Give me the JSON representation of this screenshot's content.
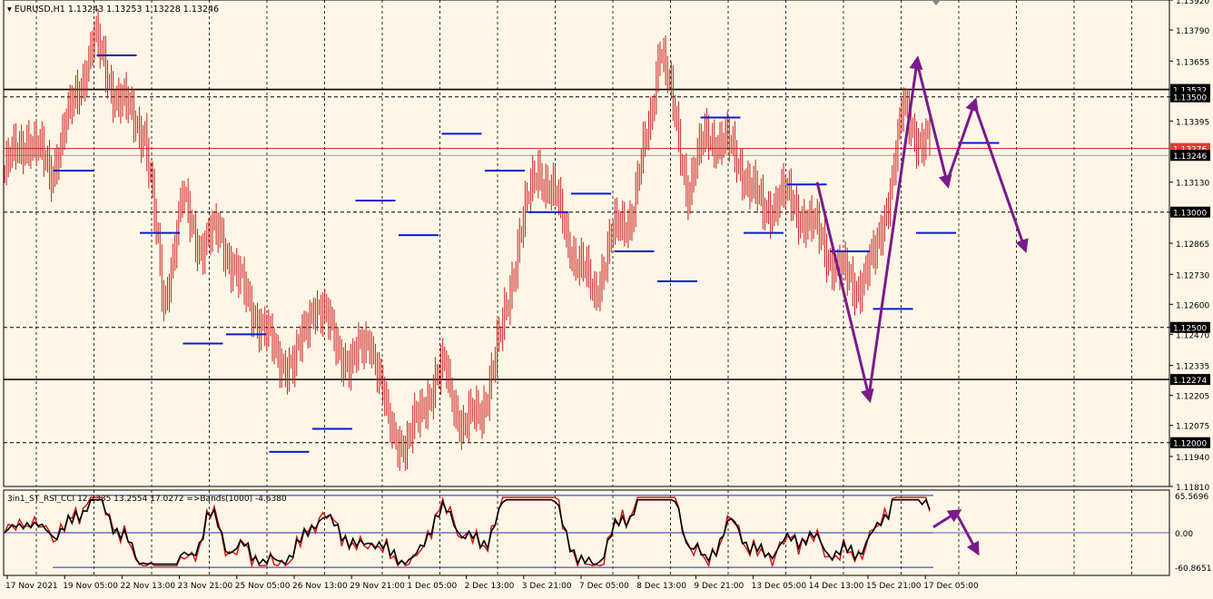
{
  "chart_data": [
    {
      "type": "candlestick",
      "header": {
        "symbol_timeframe": "EURUSD,H1",
        "open": "1.13243",
        "high": "1.13253",
        "low": "1.13228",
        "close": "1.13246"
      },
      "ylim": [
        1.1181,
        1.1392
      ],
      "y_ticks": [
        "1.13920",
        "1.13790",
        "1.13655",
        "1.13500",
        "1.13395",
        "1.13130",
        "1.13000",
        "1.12865",
        "1.12730",
        "1.12600",
        "1.12500",
        "1.12470",
        "1.12335",
        "1.12205",
        "1.12075",
        "1.12000",
        "1.11940",
        "1.11810"
      ],
      "x_ticks": [
        "17 Nov 2021",
        "19 Nov 05:00",
        "22 Nov 13:00",
        "23 Nov 21:00",
        "25 Nov 05:00",
        "26 Nov 13:00",
        "29 Nov 21:00",
        "1 Dec 05:00",
        "2 Dec 13:00",
        "3 Dec 21:00",
        "7 Dec 05:00",
        "8 Dec 13:00",
        "9 Dec 21:00",
        "13 Dec 05:00",
        "14 Dec 13:00",
        "15 Dec 21:00",
        "17 Dec 05:00"
      ],
      "horizontal_lines": [
        {
          "price": 1.13532,
          "label": "1.13532",
          "color": "#000000",
          "style": "solid"
        },
        {
          "price": 1.135,
          "label": "1.13500",
          "color": "#000000",
          "style": "dashed"
        },
        {
          "price": 1.13276,
          "label": "1.13276",
          "color": "#c62828",
          "style": "solid"
        },
        {
          "price": 1.13246,
          "label": "1.13246",
          "color": "#9e9e9e",
          "style": "solid"
        },
        {
          "price": 1.13,
          "label": "1.13000",
          "color": "#000000",
          "style": "dashed"
        },
        {
          "price": 1.125,
          "label": "1.12500",
          "color": "#000000",
          "style": "dashed"
        },
        {
          "price": 1.12274,
          "label": "1.12274",
          "color": "#000000",
          "style": "solid"
        },
        {
          "price": 1.12,
          "label": "1.12000",
          "color": "#000000",
          "style": "dashed"
        }
      ],
      "daily_pivot_levels": [
        1.1318,
        1.1368,
        1.1291,
        1.1243,
        1.1247,
        1.1196,
        1.1206,
        1.1305,
        1.129,
        1.1334,
        1.1318,
        1.13,
        1.1308,
        1.1283,
        1.127,
        1.1341,
        1.1291,
        1.1312,
        1.1283,
        1.1258,
        1.1291,
        1.133
      ],
      "projection_path": [
        [
          1.1313,
          0
        ],
        [
          1.122,
          0
        ],
        [
          1.1365,
          0
        ],
        [
          1.1313,
          0
        ],
        [
          1.1347,
          0
        ],
        [
          1.1285,
          0
        ]
      ],
      "colors": {
        "background": "#fdf6e6",
        "candles": "#cc1f1f",
        "pivots": "#0a1bd1",
        "projection": "#7a1a8c"
      }
    },
    {
      "type": "line",
      "header": "3in1_ST_RSI_CCI 12.2335 13.2554 17.0272  =>Bands(1000) -4.6380",
      "ylim": [
        -75,
        75
      ],
      "y_ticks": [
        "65.5696",
        "0.00",
        "-60.8651"
      ],
      "band_levels": {
        "upper": 65.5696,
        "middle": 0,
        "lower": -60.8651
      },
      "colors": {
        "fast": "#d01010",
        "slow": "#000000",
        "bands": "#1f2ab8"
      }
    }
  ]
}
